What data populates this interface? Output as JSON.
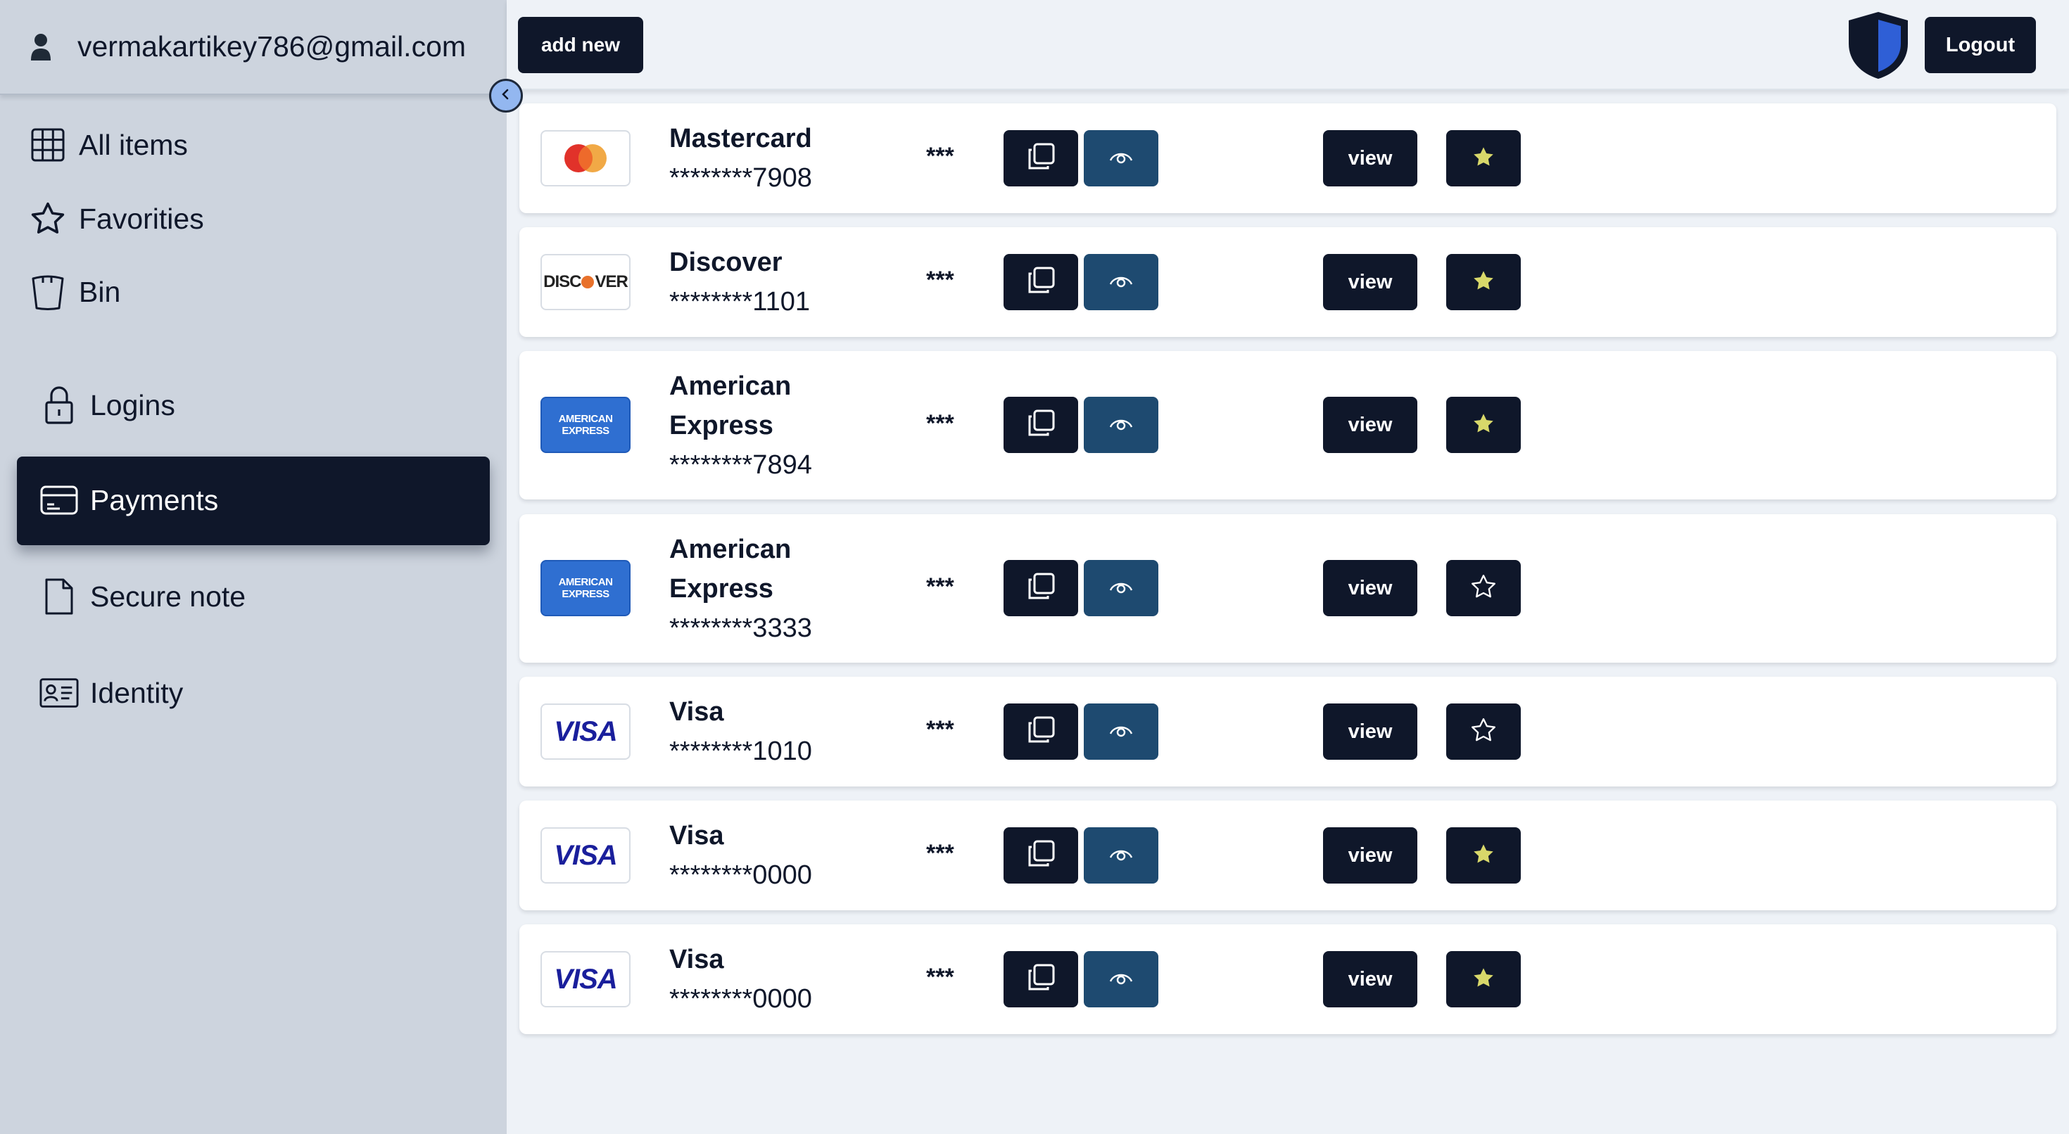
{
  "sidebar": {
    "user_email": "vermakartikey786@gmail.com",
    "items": [
      {
        "label": "All items",
        "icon": "grid-icon"
      },
      {
        "label": "Favorities",
        "icon": "star-icon"
      },
      {
        "label": "Bin",
        "icon": "bin-icon"
      },
      {
        "label": "Logins",
        "icon": "lock-icon"
      },
      {
        "label": "Payments",
        "icon": "credit-card-icon",
        "active": true
      },
      {
        "label": "Secure note",
        "icon": "document-icon"
      },
      {
        "label": "Identity",
        "icon": "id-card-icon"
      }
    ]
  },
  "header": {
    "add_label": "add new",
    "logout_label": "Logout"
  },
  "colors": {
    "dark": "#0f172a",
    "eye_button": "#1e4a70",
    "sidebar_bg": "#cdd4de",
    "page_bg": "#eef2f7",
    "star_filled": "#d8d86a"
  },
  "cards": [
    {
      "name": "Mastercard",
      "number": "********7908",
      "cvv": "***",
      "brand": "mastercard",
      "favorite": true,
      "view_label": "view"
    },
    {
      "name": "Discover",
      "number": "********1101",
      "cvv": "***",
      "brand": "discover",
      "brand_text": "DISC VER",
      "favorite": true,
      "view_label": "view"
    },
    {
      "name": "American Express",
      "number": "********7894",
      "cvv": "***",
      "brand": "amex",
      "brand_text_1": "AMERICAN",
      "brand_text_2": "EXPRESS",
      "favorite": true,
      "view_label": "view"
    },
    {
      "name": "American Express",
      "number": "********3333",
      "cvv": "***",
      "brand": "amex",
      "brand_text_1": "AMERICAN",
      "brand_text_2": "EXPRESS",
      "favorite": false,
      "view_label": "view"
    },
    {
      "name": "Visa",
      "number": "********1010",
      "cvv": "***",
      "brand": "visa",
      "brand_text": "VISA",
      "favorite": false,
      "view_label": "view"
    },
    {
      "name": "Visa",
      "number": "********0000",
      "cvv": "***",
      "brand": "visa",
      "brand_text": "VISA",
      "favorite": true,
      "view_label": "view"
    },
    {
      "name": "Visa",
      "number": "********0000",
      "cvv": "***",
      "brand": "visa",
      "brand_text": "VISA",
      "favorite": true,
      "view_label": "view"
    }
  ]
}
